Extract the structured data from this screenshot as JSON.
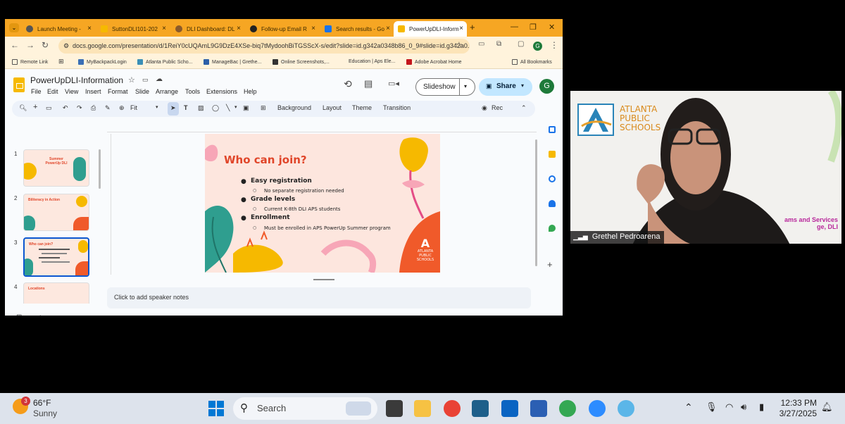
{
  "browser": {
    "tabs": [
      {
        "title": "Launch Meeting -",
        "icon_color": "#555555"
      },
      {
        "title": "SuttonDLI101-202",
        "icon_color": "#f6b900"
      },
      {
        "title": "DLI Dashboard: DL",
        "icon_color": "#8a5a2b"
      },
      {
        "title": "Follow-up Email R",
        "icon_color": "#222222"
      },
      {
        "title": "Search results - Go",
        "icon_color": "#1a73e8"
      },
      {
        "title": "PowerUpDLI-Inform",
        "icon_color": "#f6b900"
      }
    ],
    "url": "docs.google.com/presentation/d/1ReiY0cUQAmL9G9DzE4XSe-biq7tMydoohBiTGSScX-s/edit?slide=id.g342a0348b86_0_9#slide=id.g342a0...",
    "profile_initial": "G",
    "bookmarks": [
      "Remote Link",
      "MyBackpackLogin",
      "Atlanta Public Scho...",
      "ManageBac | Grethe...",
      "Online Screenshots,...",
      "Education | Aps Ele...",
      "Adobe Acrobat Home",
      "All Bookmarks"
    ]
  },
  "docs": {
    "title": "PowerUpDLI-Information",
    "menu": [
      "File",
      "Edit",
      "View",
      "Insert",
      "Format",
      "Slide",
      "Arrange",
      "Tools",
      "Extensions",
      "Help"
    ],
    "slideshow_label": "Slideshow",
    "share_label": "Share",
    "avatar_initial": "G",
    "toolbar": {
      "zoom": "Fit",
      "background": "Background",
      "layout": "Layout",
      "theme": "Theme",
      "transition": "Transition",
      "rec": "Rec"
    },
    "thumbnails": [
      {
        "num": "1",
        "title": "Summer PowerUp DLI"
      },
      {
        "num": "2",
        "title": "Biliteracy in Action"
      },
      {
        "num": "3",
        "title": "Who can join?"
      },
      {
        "num": "4",
        "title": "Locations"
      }
    ],
    "slide": {
      "title": "Who can join?",
      "bullets": [
        {
          "label": "Easy registration",
          "sub": "No separate registration needed"
        },
        {
          "label": "Grade levels",
          "sub": "Current K-8th DLI APS students"
        },
        {
          "label": "Enrollment",
          "sub": "Must be enrolled in APS PowerUp Summer program"
        }
      ],
      "logo_lines": [
        "ATLANTA",
        "PUBLIC",
        "SCHOOLS"
      ]
    },
    "speaker_notes_placeholder": "Click to add speaker notes"
  },
  "zoom": {
    "participant_name": "Grethel Pedroarena",
    "bg_logo_lines": [
      "ATLANTA",
      "PUBLIC",
      "SCHOOLS"
    ],
    "bg_text_1": "ams and Services",
    "bg_text_2": "ge, DLI"
  },
  "taskbar": {
    "weather_temp": "66°F",
    "weather_desc": "Sunny",
    "weather_badge": "3",
    "search_label": "Search",
    "time": "12:33 PM",
    "date": "3/27/2025"
  }
}
